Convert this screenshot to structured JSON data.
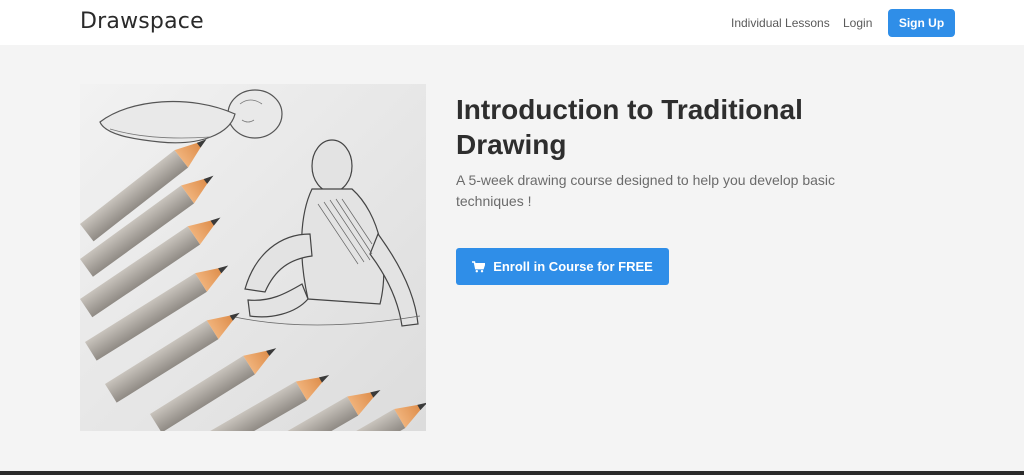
{
  "header": {
    "brand": "Drawspace",
    "nav": {
      "lessons": "Individual Lessons",
      "login": "Login",
      "signup": "Sign Up"
    }
  },
  "course": {
    "title": "Introduction to Traditional Drawing",
    "description": "A 5-week drawing course designed to help you develop basic techniques !",
    "enroll_label": "Enroll in Course for FREE",
    "enroll_icon": "cart-icon"
  },
  "colors": {
    "accent": "#2f8ee8",
    "background": "#f4f4f4",
    "header_bg": "#ffffff"
  }
}
